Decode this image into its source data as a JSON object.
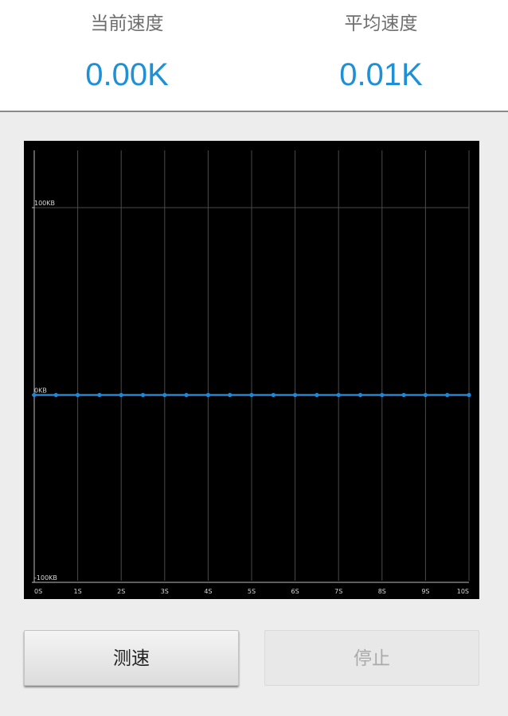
{
  "stats": {
    "current": {
      "label": "当前速度",
      "value": "0.00K"
    },
    "average": {
      "label": "平均速度",
      "value": "0.01K"
    }
  },
  "colors": {
    "accent": "#1e90d6",
    "chart_bg": "#000000",
    "line": "#1e88d6"
  },
  "chart_data": {
    "type": "line",
    "x_ticks": [
      "0S",
      "1S",
      "2S",
      "3S",
      "4S",
      "5S",
      "6S",
      "7S",
      "8S",
      "9S",
      "10S"
    ],
    "y_ticks": [
      "100KB",
      "0KB",
      "-100KB"
    ],
    "y_tick_values": [
      100,
      0,
      -100
    ],
    "xlim": [
      0,
      10
    ],
    "ylim": [
      -100,
      100
    ],
    "grid": true,
    "series": [
      {
        "x": [
          0,
          0.5,
          1,
          1.5,
          2,
          2.5,
          3,
          3.5,
          4,
          4.5,
          5,
          5.5,
          6,
          6.5,
          7,
          7.5,
          8,
          8.5,
          9,
          9.5,
          10
        ],
        "values": [
          0,
          0,
          0,
          0,
          0,
          0,
          0,
          0,
          0,
          0,
          0,
          0,
          0,
          0,
          0,
          0,
          0,
          0,
          0,
          0,
          0
        ]
      }
    ]
  },
  "buttons": {
    "start_label": "测速",
    "stop_label": "停止"
  }
}
